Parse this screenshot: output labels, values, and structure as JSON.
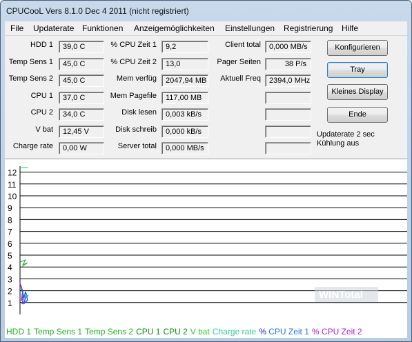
{
  "window": {
    "title": "CPUCooL  Vers 8.1.0  Dec  4 2011 (nicht registriert)"
  },
  "menu": [
    "File",
    "Updaterate",
    "Funktionen",
    "Anzeigemöglichkeiten",
    "Einstellungen",
    "Registrierung",
    "Hilfe"
  ],
  "col1": [
    {
      "label": "HDD 1",
      "value": "39,0 C"
    },
    {
      "label": "Temp Sens 1",
      "value": "45,0 C"
    },
    {
      "label": "Temp Sens 2",
      "value": "45,0 C"
    },
    {
      "label": "CPU 1",
      "value": "37,0 C"
    },
    {
      "label": "CPU 2",
      "value": "34,0 C"
    },
    {
      "label": "V bat",
      "value": "12,45 V"
    },
    {
      "label": "Charge rate",
      "value": "0,00 W"
    }
  ],
  "col2": [
    {
      "label": "% CPU Zeit 1",
      "value": "9,2"
    },
    {
      "label": "% CPU Zeit 2",
      "value": "13,0"
    },
    {
      "label": "Mem verfüg",
      "value": "2047,94 MB"
    },
    {
      "label": "Mem Pagefile",
      "value": "117,00 MB"
    },
    {
      "label": "Disk lesen",
      "value": "0,003 kB/s"
    },
    {
      "label": "Disk schreib",
      "value": "0,000 kB/s"
    },
    {
      "label": "Server total",
      "value": "0,000 MB/s"
    }
  ],
  "col3": [
    {
      "label": "Client total",
      "value": "0,000 MB/s"
    },
    {
      "label": "Pager Seiten",
      "value": "38 P/s"
    },
    {
      "label": "Aktuell Freq",
      "value": "2394,0 MHz"
    },
    {
      "label": "",
      "value": ""
    },
    {
      "label": "",
      "value": ""
    },
    {
      "label": "",
      "value": ""
    },
    {
      "label": "",
      "value": ""
    }
  ],
  "buttons": {
    "configure": "Konfigurieren",
    "tray": "Tray",
    "small_display": "Kleines Display",
    "end": "Ende"
  },
  "info": {
    "update_rate": "Updaterate 2 sec",
    "cooling": "Kühlung aus"
  },
  "chart_data": {
    "type": "line",
    "y_ticks": [
      "12",
      "11",
      "10",
      "9",
      "8",
      "7",
      "6",
      "5",
      "4",
      "3",
      "2",
      "1"
    ],
    "ylim": [
      0,
      12.5
    ],
    "grid": true,
    "series": [
      {
        "name": "HDD 1",
        "color": "#22aa22"
      },
      {
        "name": "Temp Sens 1",
        "color": "#22aa22"
      },
      {
        "name": "Temp Sens 2",
        "color": "#22aa22"
      },
      {
        "name": "CPU 1",
        "color": "#118811"
      },
      {
        "name": "CPU 2",
        "color": "#118811"
      },
      {
        "name": "V bat",
        "color": "#33cc33"
      },
      {
        "name": "Charge rate",
        "color": "#33cc99"
      },
      {
        "name": "% CPU Zeit 1",
        "color": "#2277ee"
      },
      {
        "name": "% CPU Zeit 2",
        "color": "#aa22cc"
      }
    ],
    "legend_separator_color": "#1f1fcc",
    "legend_separator_color2": "#aa22cc",
    "watermark": "WINTotal"
  }
}
